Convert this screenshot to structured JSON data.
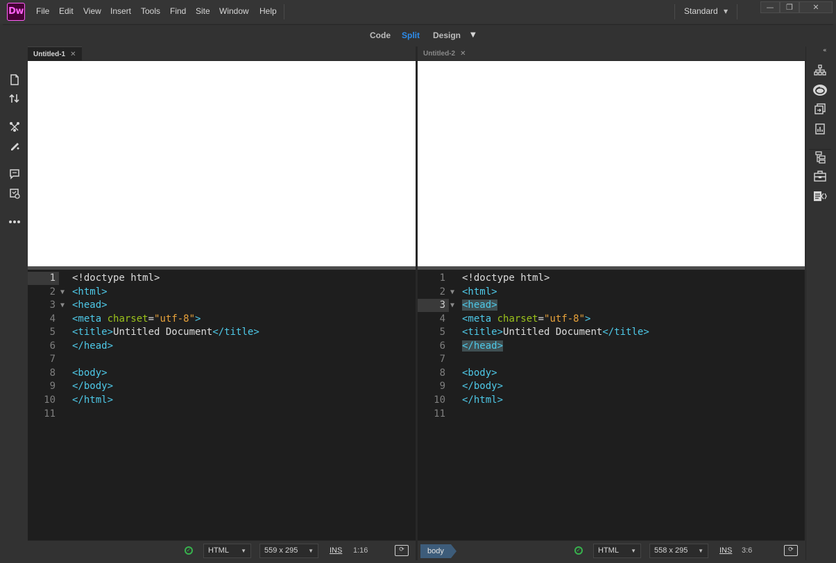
{
  "app": {
    "logo_text": "Dw",
    "menu": [
      "File",
      "Edit",
      "View",
      "Insert",
      "Tools",
      "Find",
      "Site",
      "Window",
      "Help"
    ],
    "workspace": "Standard",
    "window_buttons": [
      "—",
      "❐",
      "✕"
    ]
  },
  "view_switcher": {
    "code": "Code",
    "split": "Split",
    "design": "Design",
    "active": "Split",
    "active_color": "#2d8ceb"
  },
  "left_toolbar": [
    "file-icon",
    "transfer-icon",
    "extract-icon",
    "ruler-icon",
    "comment-icon",
    "validate-icon",
    "more-icon"
  ],
  "right_toolbar": [
    "site-tree-icon",
    "creative-cloud-icon",
    "files-icon",
    "assets-icon",
    "dom-icon",
    "insert-icon",
    "css-designer-icon"
  ],
  "documents": [
    {
      "tab": "Untitled-1",
      "active": true,
      "highlight_line": 1,
      "status": {
        "doc_type": "HTML",
        "size": "559 x 295",
        "mode": "INS",
        "cursor": "1:16"
      }
    },
    {
      "tab": "Untitled-2",
      "active": false,
      "highlight_line": 3,
      "breadcrumb": "body",
      "status": {
        "doc_type": "HTML",
        "size": "558 x 295",
        "mode": "INS",
        "cursor": "3:6"
      }
    }
  ],
  "code": {
    "line_numbers": [
      "1",
      "2",
      "3",
      "4",
      "5",
      "6",
      "7",
      "8",
      "9",
      "10",
      "11"
    ],
    "lines": [
      "<!doctype html>",
      "<html>",
      "<head>",
      "<meta charset=\"utf-8\">",
      "<title>Untitled Document</title>",
      "</head>",
      "",
      "<body>",
      "</body>",
      "</html>",
      ""
    ],
    "foldable": [
      2,
      3
    ]
  },
  "colors": {
    "tag": "#4ec9e8",
    "attr": "#9cc31b",
    "value": "#e8a23a",
    "plain": "#dcdcdc",
    "accent": "#2d8ceb"
  }
}
